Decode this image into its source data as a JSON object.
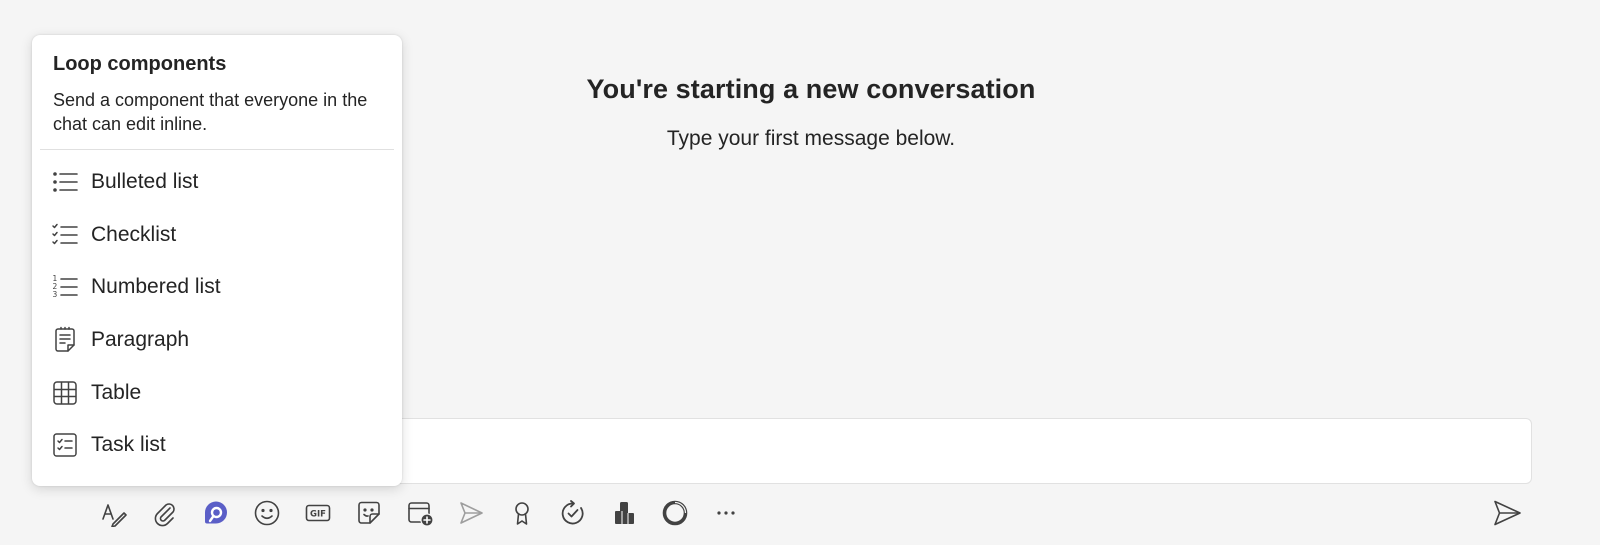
{
  "conversation": {
    "title": "You're starting a new conversation",
    "subtitle": "Type your first message below."
  },
  "loop_popup": {
    "title": "Loop components",
    "description": "Send a component that everyone in the chat can edit inline.",
    "items": [
      {
        "label": "Bulleted list",
        "icon": "bulleted-list-icon"
      },
      {
        "label": "Checklist",
        "icon": "checklist-icon"
      },
      {
        "label": "Numbered list",
        "icon": "numbered-list-icon"
      },
      {
        "label": "Paragraph",
        "icon": "paragraph-icon"
      },
      {
        "label": "Table",
        "icon": "table-icon"
      },
      {
        "label": "Task list",
        "icon": "task-list-icon"
      }
    ]
  },
  "toolbar": {
    "items": [
      "format-icon",
      "attach-icon",
      "loop-icon",
      "emoji-icon",
      "gif-icon",
      "sticker-icon",
      "schedule-meeting-icon",
      "stream-icon",
      "praise-icon",
      "updates-icon",
      "app-icon",
      "loop-circle-icon",
      "more-icon"
    ],
    "send_icon": "send-icon",
    "accent_color": "#5b5fc7"
  },
  "colors": {
    "background": "#f5f5f5",
    "surface": "#ffffff",
    "text": "#242424"
  }
}
